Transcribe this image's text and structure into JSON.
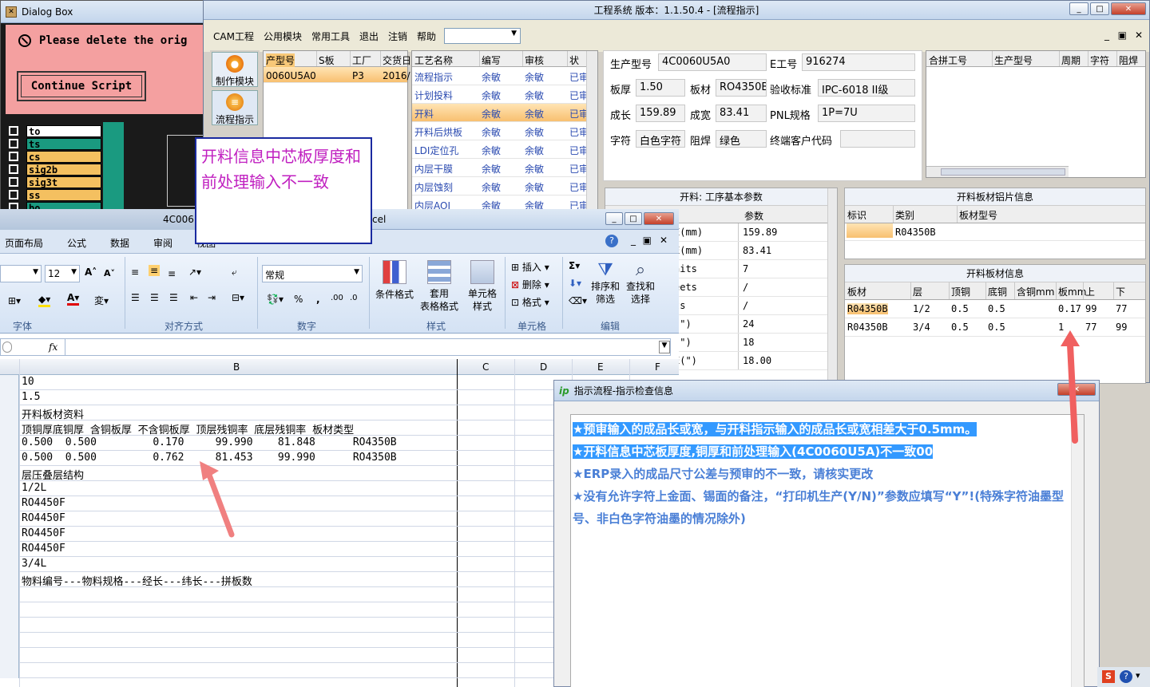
{
  "dialog": {
    "title": "Dialog Box",
    "message": "Please delete the orig",
    "button": "Continue Script",
    "layers": [
      "to",
      "ts",
      "cs",
      "sig2b",
      "sig3t",
      "ss",
      "bo"
    ]
  },
  "main": {
    "title": "工程系统  版本：1.1.50.4 - [流程指示]",
    "menu": [
      "CAM工程",
      "公用模块",
      "常用工具",
      "退出",
      "注销",
      "帮助"
    ],
    "side_buttons": [
      "制作模块",
      "流程指示"
    ],
    "orders": {
      "headers": [
        "产型号",
        "S板",
        "工厂",
        "交货日"
      ],
      "rows": [
        [
          "0060U5A0",
          "",
          "P3",
          "2016/"
        ]
      ]
    },
    "process": {
      "headers": [
        "工艺名称",
        "编写",
        "审核",
        "状"
      ],
      "rows": [
        [
          "流程指示",
          "余敏",
          "余敏",
          "已审"
        ],
        [
          "计划投料",
          "余敏",
          "余敏",
          "已审"
        ],
        [
          "开料",
          "余敏",
          "余敏",
          "已审"
        ],
        [
          "开料后烘板",
          "余敏",
          "余敏",
          "已审"
        ],
        [
          "LDI定位孔",
          "余敏",
          "余敏",
          "已审"
        ],
        [
          "内层干膜",
          "余敏",
          "余敏",
          "已审"
        ],
        [
          "内层蚀刻",
          "余敏",
          "余敏",
          "已审"
        ],
        [
          "内层AOI",
          "余敏",
          "余敏",
          "已审"
        ]
      ]
    },
    "info": {
      "model_label": "生产型号",
      "model": "4C0060U5A0",
      "eno_label": "E工号",
      "eno": "916274",
      "thick_label": "板厚",
      "thick": "1.50",
      "mat_label": "板材",
      "mat": "RO4350B",
      "std_label": "验收标准",
      "std": "IPC-6018 II级",
      "len_label": "成长",
      "len": "159.89",
      "wid_label": "成宽",
      "wid": "83.41",
      "pnl_label": "PNL规格",
      "pnl": "1P=7U",
      "char_label": "字符",
      "char": "白色字符",
      "mask_label": "阻焊",
      "mask": "绿色",
      "cust_label": "终端客户代码",
      "cust": ""
    },
    "merge_headers": [
      "合拼工号",
      "生产型号",
      "周期",
      "字符",
      "阻焊"
    ],
    "cut_params": {
      "title": "开料: 工序基本参数",
      "col": "参数",
      "rows": [
        [
          "E(mm)",
          "159.89"
        ],
        [
          "E(mm)",
          "83.41"
        ],
        [
          "nits",
          "7"
        ],
        [
          "eets",
          "/"
        ],
        [
          "ts",
          "/"
        ],
        [
          "(\")",
          "24"
        ],
        [
          "(\")",
          "18"
        ],
        [
          "E(\")",
          "18.00"
        ]
      ]
    },
    "al_sheet": {
      "title": "开料板材铝片信息",
      "headers": [
        "标识",
        "类别",
        "板材型号"
      ],
      "rows": [
        [
          "",
          "R04350B",
          ""
        ]
      ]
    },
    "board_info": {
      "title": "开料板材信息",
      "headers": [
        "板材",
        "层",
        "顶铜",
        "底铜",
        "含铜mm",
        "板mm",
        "上",
        "下"
      ],
      "rows": [
        [
          "R04350B",
          "1/2",
          "0.5",
          "0.5",
          "",
          "0.17",
          "99",
          "77"
        ],
        [
          "R04350B",
          "3/4",
          "0.5",
          "0.5",
          "",
          "1",
          "77",
          "99"
        ]
      ]
    }
  },
  "callout": "开料信息中芯板厚度和前处理输入不一致",
  "excel": {
    "title_frag": "cel",
    "behind_frag": "4C006",
    "tabs": [
      "页面布局",
      "公式",
      "数据",
      "审阅",
      "视图"
    ],
    "font_size": "12",
    "number_format": "常规",
    "groups": [
      "字体",
      "对齐方式",
      "数字",
      "样式",
      "单元格",
      "编辑"
    ],
    "styles_buttons": [
      "条件格式",
      "套用\n表格格式",
      "单元格\n样式"
    ],
    "cells_buttons": [
      "插入",
      "删除",
      "格式"
    ],
    "edit_buttons": [
      "排序和\n筛选",
      "查找和\n选择"
    ],
    "fx": "fx",
    "columns": [
      "B",
      "C",
      "D",
      "E",
      "F"
    ],
    "rows": [
      "10",
      "1.5",
      "开料板材资料",
      "顶铜厚底铜厚 含铜板厚 不含铜板厚 顶层残铜率 底层残铜率 板材类型",
      "0.500  0.500         0.170     99.990    81.848      RO4350B",
      "0.500  0.500         0.762     81.453    99.990      RO4350B",
      "层压叠层结构",
      "1/2L",
      "RO4450F",
      "RO4450F",
      "RO4450F",
      "RO4450F",
      "3/4L",
      "物料编号---物料规格---经长---纬长---拼板数"
    ]
  },
  "check": {
    "title": "指示流程-指示检查信息",
    "items": [
      "★预审输入的成品长或宽，与开料指示输入的成品长或宽相差大于0.5mm。",
      "★开料信息中芯板厚度,铜厚和前处理输入(4C0060U5A)不一致00",
      "★ERP录入的成品尺寸公差与预审的不一致，请核实更改",
      "★没有允许字符上金面、锡面的备注，“打印机生产(Y/N)”参数应填写“Y”!(特殊字符油墨型号、非白色字符油墨的情况除外)"
    ]
  },
  "colors": {
    "accent_red": "#e84c4c",
    "highlight_blue": "#3399ff",
    "text_blue": "#4a7fd6",
    "callout_magenta": "#c020c0",
    "dialog_pink": "#f4a0a0"
  }
}
